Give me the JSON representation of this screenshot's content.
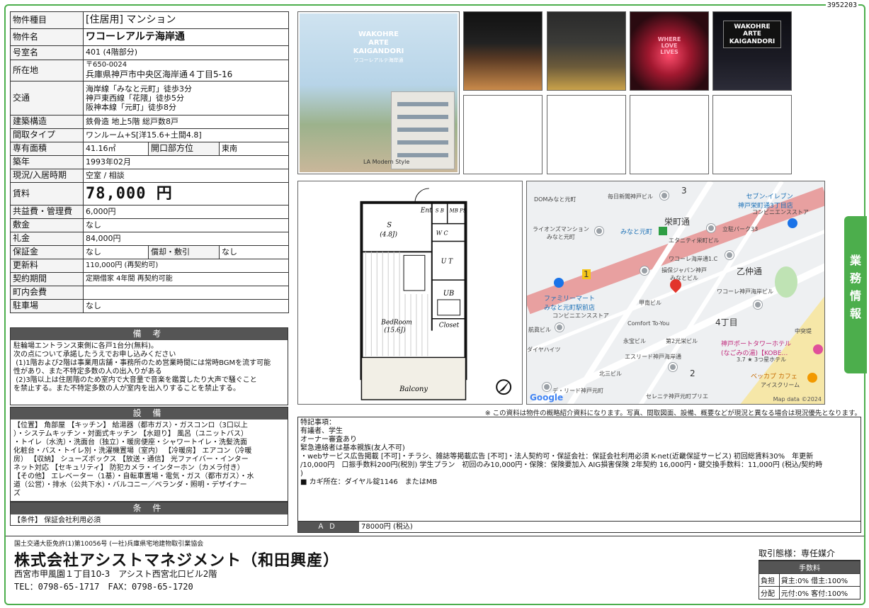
{
  "doc_number": "3952203",
  "property": {
    "type_label": "物件種目",
    "type_value": "[住居用] マンション",
    "name_label": "物件名",
    "name_value": "ワコーレアルテ海岸通",
    "room_label": "号室名",
    "room_value": "401 (4階部分)",
    "location_label": "所在地",
    "postal": "〒650-0024",
    "address": "兵庫県神戸市中央区海岸通４丁目5-16",
    "transport_label": "交通",
    "transport": [
      "海岸線「みなと元町」徒歩3分",
      "神戸東西線「花隈」徒歩5分",
      "阪神本線「元町」徒歩8分"
    ],
    "structure_label": "建築構造",
    "structure_value": "鉄骨造 地上5階 総戸数8戸",
    "layout_label": "間取タイプ",
    "layout_value": "ワンルーム+S[洋15.6+土間4.8]",
    "area_label": "専有面積",
    "area_value": "41.16㎡",
    "direction_label": "開口部方位",
    "direction_value": "東南",
    "built_label": "築年",
    "built_value": "1993年02月",
    "status_label": "現況/入居時期",
    "status_value": "空室 / 相談",
    "rent_label": "賃料",
    "rent_value": "78,000 円",
    "mgmt_label": "共益費・管理費",
    "mgmt_value": "6,000円",
    "deposit_label": "敷金",
    "deposit_value": "なし",
    "key_money_label": "礼金",
    "key_money_value": "84,000円",
    "guarantee_label": "保証金",
    "guarantee_value": "なし",
    "amort_label": "償却・敷引",
    "amort_value": "なし",
    "renewal_label": "更新料",
    "renewal_value": "110,000円 (再契約可)",
    "contract_label": "契約期間",
    "contract_value": "定期借家 4年間 再契約可能",
    "assoc_label": "町内会費",
    "assoc_value": "",
    "parking_label": "駐車場",
    "parking_value": "なし"
  },
  "bikou": {
    "title": "備 考",
    "text": "駐輪場エントランス東側に各戸1台分(無料)。\n次の点について承諾したうえでお申し込みください\n (1)1階および2階は事業用店舗・事務所のため営業時間には常時BGMを流す可能\n性があり、また不特定多数の人の出入りがある\n (2)3階以上は住居階のため室内で大音量で音楽を鑑賞したり大声で騒ぐこと\nを禁止する。また不特定多数の人が室内を出入りすることを禁止する。"
  },
  "setsubi": {
    "title": "設 備",
    "text": "【位置】 角部屋 【キッチン】 給湯器（都市ガス）・ガスコンロ（3口以上\n）・システムキッチン・対面式キッチン 【水廻り】 風呂（ユニットバス）\n・トイレ（水洗）・洗面台（独立）・暖房便座・シャワートイレ・洗髪洗面\n化粧台・バス・トイレ別・洗濯機置場（室内） 【冷暖房】 エアコン（冷暖\n房） 【収納】 シューズボックス 【放送・通信】 光ファイバー・インター\nネット対応 【セキュリティ】 防犯カメラ・インターホン（カメラ付き）\n【その他】 エレベーター（1基）・自転車置場・電気・ガス（都市ガス）・水\n道（公営）・排水（公共下水）・バルコニー／ベランダ・照明・デザイナー\nズ"
  },
  "jouken": {
    "title": "条 件",
    "text": "【条件】 保証会社利用必須"
  },
  "photos": {
    "main_brand": "WAKOHRE\nARTE\nKAIGANDORI",
    "main_sub": "ワコーレアルテ海岸通",
    "main_style": "LA Modern Style",
    "neon_text": "WHERE\nLOVE\nLIVES",
    "sign_text": "WAKOHRE\nARTE\nKAIGANDORI"
  },
  "floorplan": {
    "ent": "Ent",
    "sb": "S\nB",
    "mbps": "MB\nPS",
    "s_room": "S",
    "s_size": "(4.8J)",
    "wc": "W\nC",
    "ut": "U\nT",
    "ub": "UB",
    "bedroom": "BedRoom",
    "bed_size": "(15.6J)",
    "closet": "Closet",
    "balcony": "Balcony"
  },
  "map": {
    "labels": {
      "dom": "DOMみなと元町",
      "mainichi": "毎日新聞神戸ビル",
      "num3": "3",
      "seven": "セブン-イレブン\n神戸栄町通3丁目店",
      "seven_sub": "コンビニエンスストア",
      "sakae": "栄町通",
      "lions": "ライオンズマンション\nみなと元町",
      "minato_station": "みなと元町",
      "tachihi": "立駐パーク33",
      "eternity": "エタニティ栄町ビル",
      "wakohre1": "ワコーレ海岸通1.C",
      "otsu": "乙仲通",
      "sompo": "損保ジャパン神戸\nみなとビル",
      "wakohre_b": "ワコーレ神戸海岸ビル",
      "family": "ファミリーマート\nみなと元町駅前店",
      "family_sub": "コンビニエンスストア",
      "koden": "甲南ビル",
      "comfort": "Comfort To-You",
      "chome4": "4丁目",
      "koushin": "航眞ビル",
      "chuo": "中突堤",
      "eiho": "永宝ビル",
      "sakae2": "第2光栄ビル",
      "daiya": "ダイヤハイツ",
      "esreed": "エスリード神戸海岸通",
      "port": "神戸ポートタワーホテル\n(なごみの湯)【KOBE…",
      "rating": "3.7 ★ 3つ星ホテル",
      "kita3": "北三ビル",
      "num2": "2",
      "bekkapu": "ベッカプ カフェ",
      "ice": "アイスクリーム",
      "dereed": "デ・リード神戸元町",
      "serenite": "セレニテ神戸元町プリエ",
      "route1": "1"
    },
    "google": "Google",
    "map_data": "Map data ©2024"
  },
  "side_tab": "業\n務\n情\n報",
  "disclaimer": "※ この資料は物件の概略紹介資料になります。写真、間取図面、設備、概要などが現況と異なる場合は現況優先となります。",
  "remarks": {
    "text": "特記事項：\n有議者、学生\nオーナー審査あり\n緊急連絡者は基本親族(友人不可)\n・webサービス広告掲載 [不可]・チラシ、雑誌等掲載広告 [不可]・法人契約可・保証会社：保証会社利用必須 K-net(近畿保証サービス) 初回総賃料30%　年更新\n/10,000円　口振手数料200円(税別) 学生プラン　初回のみ10,000円・保険：保険要加入 AIG損害保険 2年契約 16,000円・鍵交換手数料：11,000円 (税込/契約時\n)\n■ カギ所在：ダイヤル錠1146　またはMB",
    "ad_label": "ＡＤ",
    "ad_value": "78000円 (税込)"
  },
  "company": {
    "license": "国土交通大臣免許(1)第10056号 (一社)兵庫県宅地建物取引業協会",
    "name": "株式会社アシストマネジメント（和田興産）",
    "address": "西宮市甲風園１丁目10-3　アシスト西宮北口ビル2階",
    "tel": "TEL：0798-65-1717　FAX：0798-65-1720"
  },
  "fee": {
    "mode": "取引態様：専任媒介",
    "header": "手数料",
    "burden_label": "負担",
    "burden_value": "貸主:0% 借主:100%",
    "split_label": "分配",
    "split_value": "元付:0% 客付:100%"
  },
  "colors": {
    "accent": "#4cae4c",
    "header_bg": "#555555",
    "map_rail": "#e8a0a0"
  }
}
